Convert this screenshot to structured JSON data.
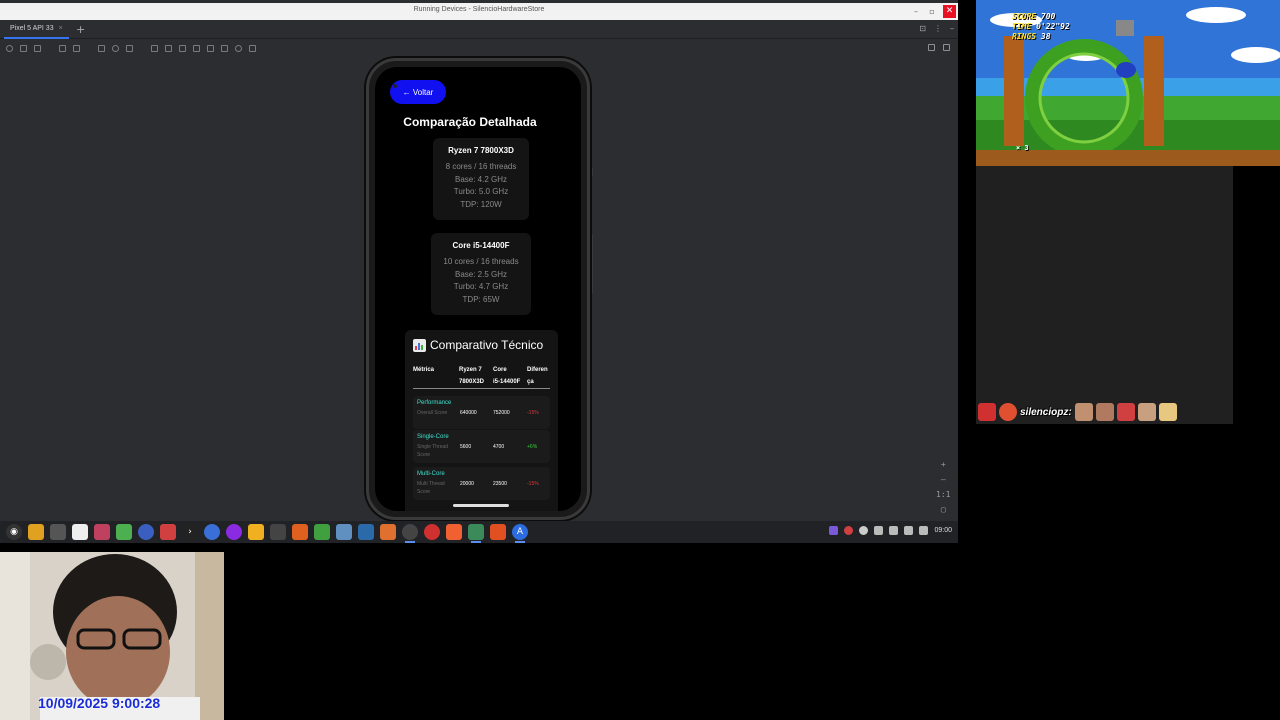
{
  "window": {
    "title": "Running Devices - SilencioHardwareStore",
    "device_tab": "Pixel 5 API 33"
  },
  "app": {
    "back_label": "← Voltar",
    "page_title": "Comparação Detalhada",
    "cpus": [
      {
        "name": "Ryzen 7 7800X3D",
        "cores": "8 cores / 16 threads",
        "base": "Base: 4.2 GHz",
        "turbo": "Turbo: 5.0 GHz",
        "tdp": "TDP: 120W"
      },
      {
        "name": "Core i5-14400F",
        "cores": "10 cores / 16 threads",
        "base": "Base: 2.5 GHz",
        "turbo": "Turbo: 4.7 GHz",
        "tdp": "TDP: 65W"
      }
    ],
    "table": {
      "title": "Comparativo Técnico",
      "headers": {
        "metric": "Métrica",
        "col1_line1": "Ryzen 7",
        "col1_line2": "7800X3D",
        "col2_line1": "Core",
        "col2_line2": "i5-14400F",
        "diff_line1": "Diferen",
        "diff_line2": "ça"
      },
      "rows": [
        {
          "metric": "Performance",
          "desc": "Overall Score",
          "v1": "640000",
          "v2": "752000",
          "diff": "-15%",
          "diff_color": "#e03a3a"
        },
        {
          "metric": "Single-Core",
          "desc": "Single Thread Score",
          "v1": "5600",
          "v2": "4700",
          "diff": "+6%",
          "diff_color": "#36d236"
        },
        {
          "metric": "Multi-Core",
          "desc": "Multi Thread Score",
          "v1": "20000",
          "v2": "23500",
          "diff": "-15%",
          "diff_color": "#e03a3a"
        }
      ]
    }
  },
  "taskbar": {
    "clock": "09:00"
  },
  "game": {
    "score_label": "SCORE",
    "score": "700",
    "time_label": "TIME",
    "time": "0'22\"92",
    "rings_label": "RINGS",
    "rings": "38",
    "lives": "× 3"
  },
  "stream": {
    "name": "silenciopz:"
  },
  "webcam": {
    "timestamp": "10/09/2025 9:00:28"
  },
  "colors": {
    "accent": "#1010f0",
    "metric": "#3fe0d0",
    "negative": "#e03a3a",
    "positive": "#36d236"
  }
}
